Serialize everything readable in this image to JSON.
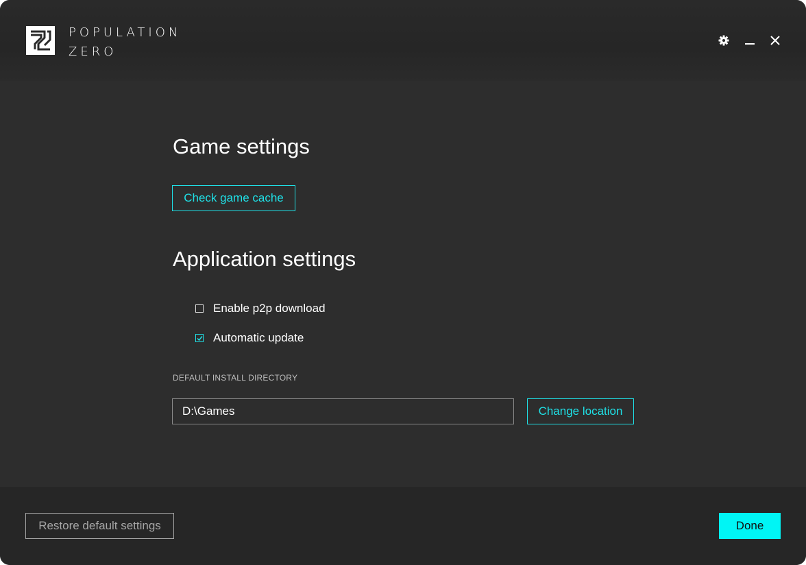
{
  "app": {
    "logo_line1": "POPULATION",
    "logo_line2": "ZERO",
    "logo_icon": "population-zero-logo"
  },
  "window_controls": {
    "settings_icon": "gear-icon",
    "minimize_icon": "minimize-icon",
    "close_icon": "close-icon"
  },
  "game_settings": {
    "heading": "Game settings",
    "check_cache_label": "Check game cache"
  },
  "app_settings": {
    "heading": "Application settings",
    "options": [
      {
        "label": "Enable p2p download",
        "checked": false
      },
      {
        "label": "Automatic update",
        "checked": true
      }
    ],
    "install_dir_label": "DEFAULT INSTALL DIRECTORY",
    "install_dir_value": "D:\\Games",
    "change_location_label": "Change location"
  },
  "footer": {
    "restore_label": "Restore default settings",
    "done_label": "Done"
  },
  "colors": {
    "accent": "#1fe0e6",
    "primary_button": "#00f5f5",
    "background": "#2d2d2d"
  }
}
